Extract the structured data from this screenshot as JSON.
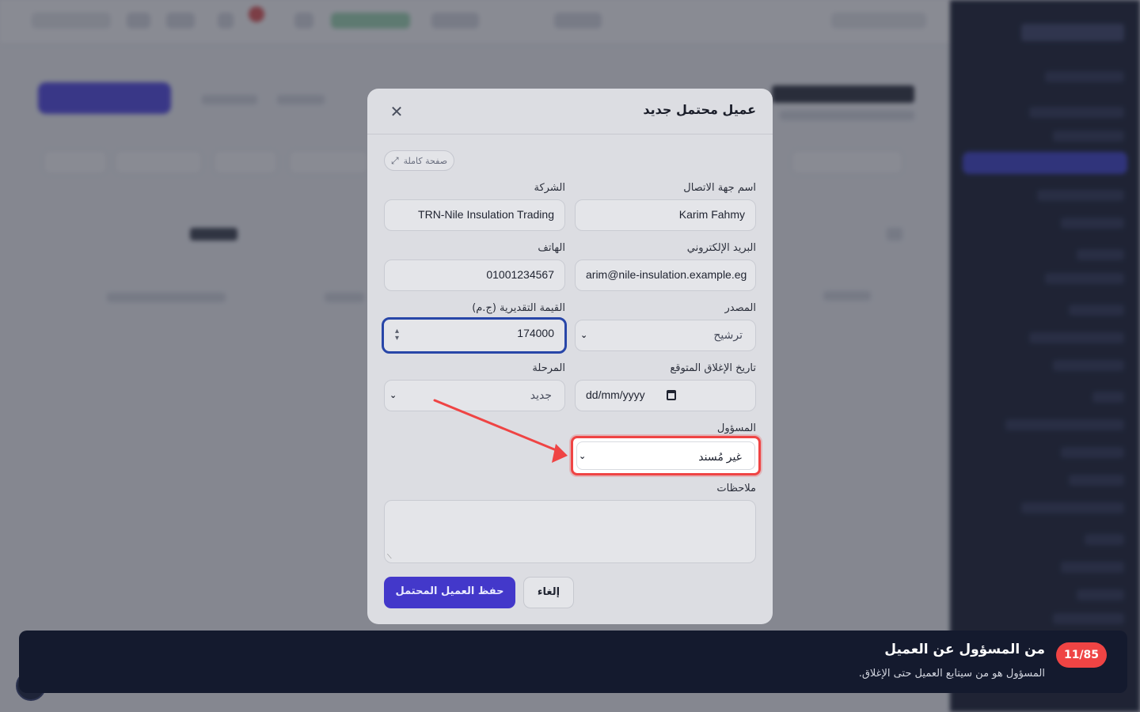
{
  "modal": {
    "title": "عميل محتمل جديد",
    "close_icon": "close-icon",
    "fullpage_label": "صفحة كاملة",
    "fullpage_icon": "expand-icon",
    "fields": {
      "contact_name": {
        "label": "اسم جهة الاتصال",
        "value": "Karim Fahmy"
      },
      "company": {
        "label": "الشركة",
        "value": "TRN-Nile Insulation Trading"
      },
      "email": {
        "label": "البريد الإلكتروني",
        "value": "arim@nile-insulation.example.eg"
      },
      "phone": {
        "label": "الهاتف",
        "value": "01001234567"
      },
      "source": {
        "label": "المصدر",
        "value": "ترشيح"
      },
      "estimated_value": {
        "label": "القيمة التقديرية (ج.م)",
        "value": "174000"
      },
      "expected_close": {
        "label": "تاريخ الإغلاق المتوقع",
        "placeholder": "dd/mm/yyyy"
      },
      "stage": {
        "label": "المرحلة",
        "value": "جديد"
      },
      "owner": {
        "label": "المسؤول",
        "value": "غير مُسند"
      },
      "notes": {
        "label": "ملاحظات",
        "value": ""
      }
    },
    "save_label": "حفظ العميل المحتمل",
    "cancel_label": "إلغاء"
  },
  "tour": {
    "step": "11/85",
    "title": "من المسؤول عن العميل",
    "description": "المسؤول هو من سيتابع العميل حتى الإغلاق."
  },
  "colors": {
    "primary": "#4338ca",
    "highlight": "#ef4444",
    "banner_bg": "#141a2e",
    "sidebar_bg": "#141a2e"
  }
}
